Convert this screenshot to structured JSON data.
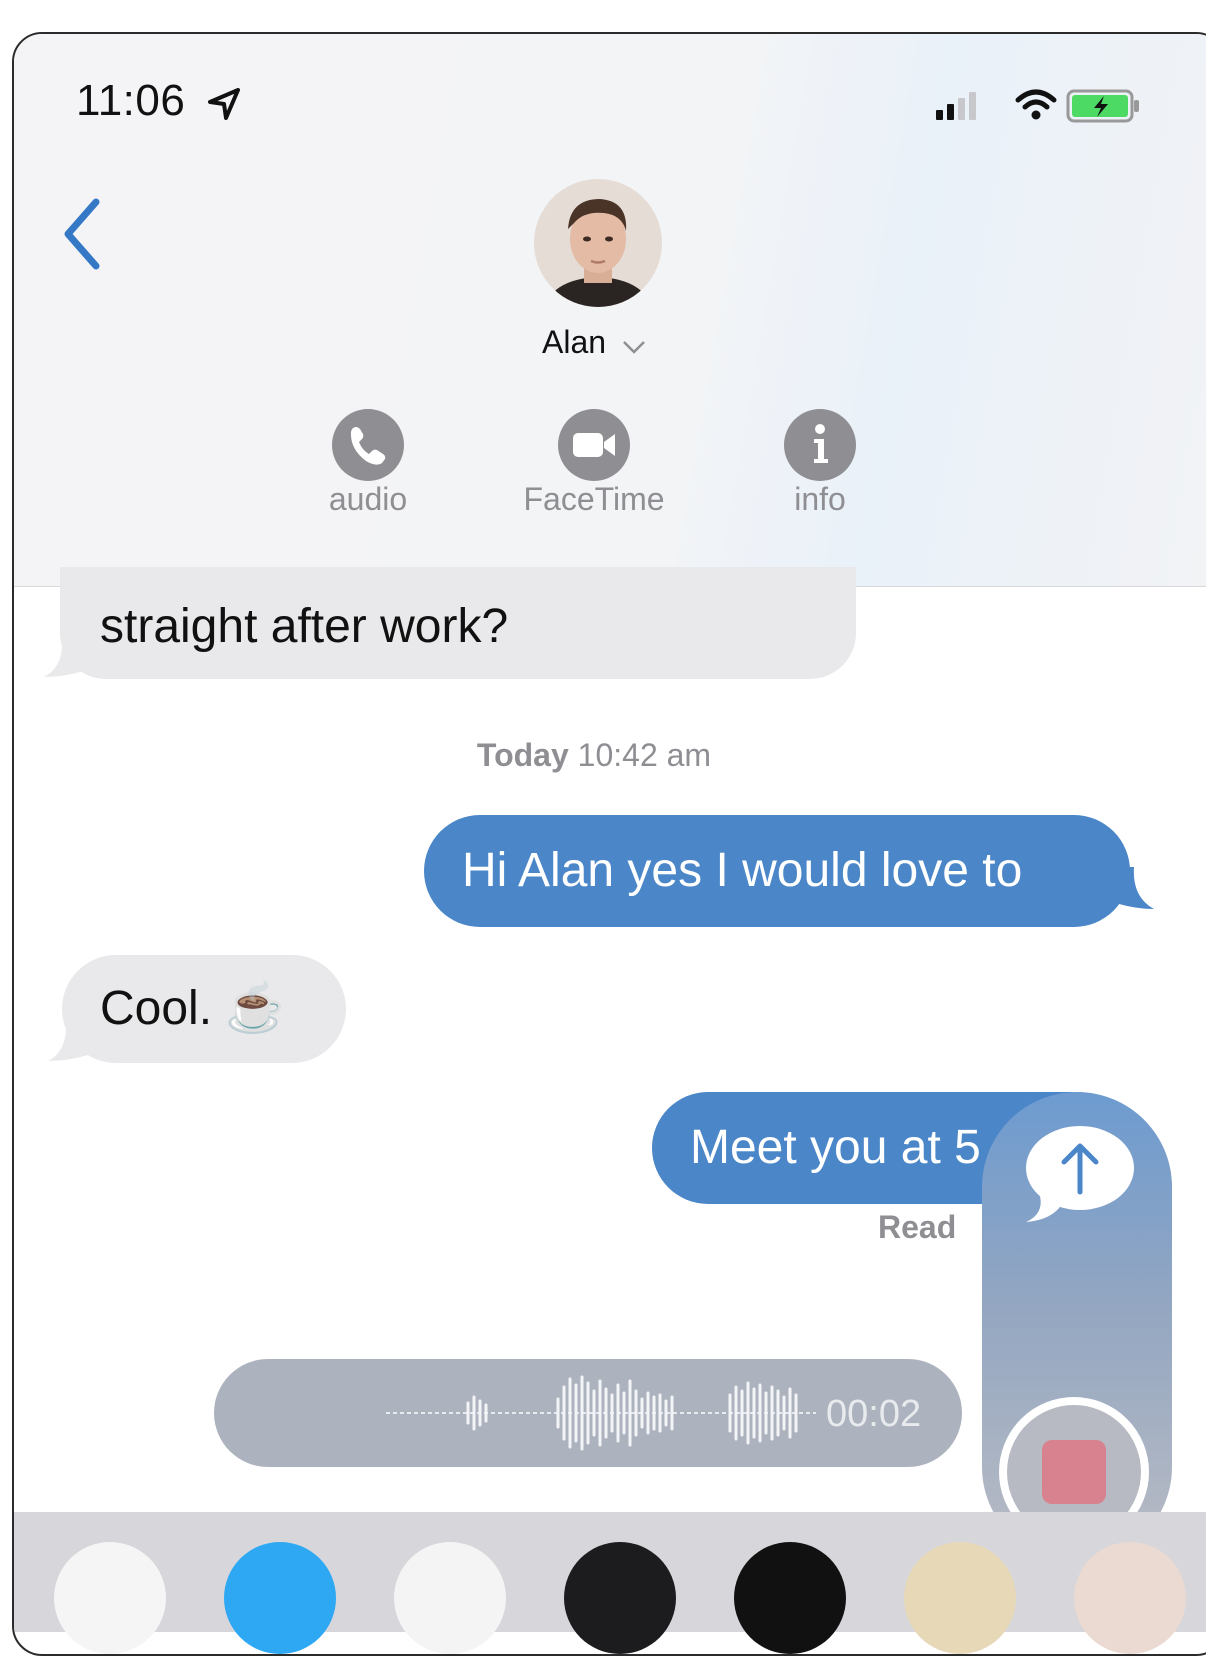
{
  "status_bar": {
    "time": "11:06"
  },
  "header": {
    "contact_name": "Alan",
    "actions": [
      {
        "label": "audio",
        "icon": "phone-icon"
      },
      {
        "label": "FaceTime",
        "icon": "video-camera-icon"
      },
      {
        "label": "info",
        "icon": "info-icon"
      }
    ]
  },
  "messages": [
    {
      "direction": "incoming",
      "text": "straight after work?"
    },
    {
      "direction": "outgoing",
      "text": "Hi Alan yes I would love to"
    },
    {
      "direction": "incoming",
      "text": "Cool. ☕"
    },
    {
      "direction": "outgoing",
      "text": "Meet you at 5"
    }
  ],
  "timestamp": {
    "day": "Today",
    "time": "10:42 am"
  },
  "read_receipt": "Read",
  "voice_message": {
    "duration": "00:02"
  },
  "colors": {
    "accent": "#4a86c8",
    "incoming_bubble": "#e9e9eb",
    "secondary_text": "#8e8e93"
  }
}
